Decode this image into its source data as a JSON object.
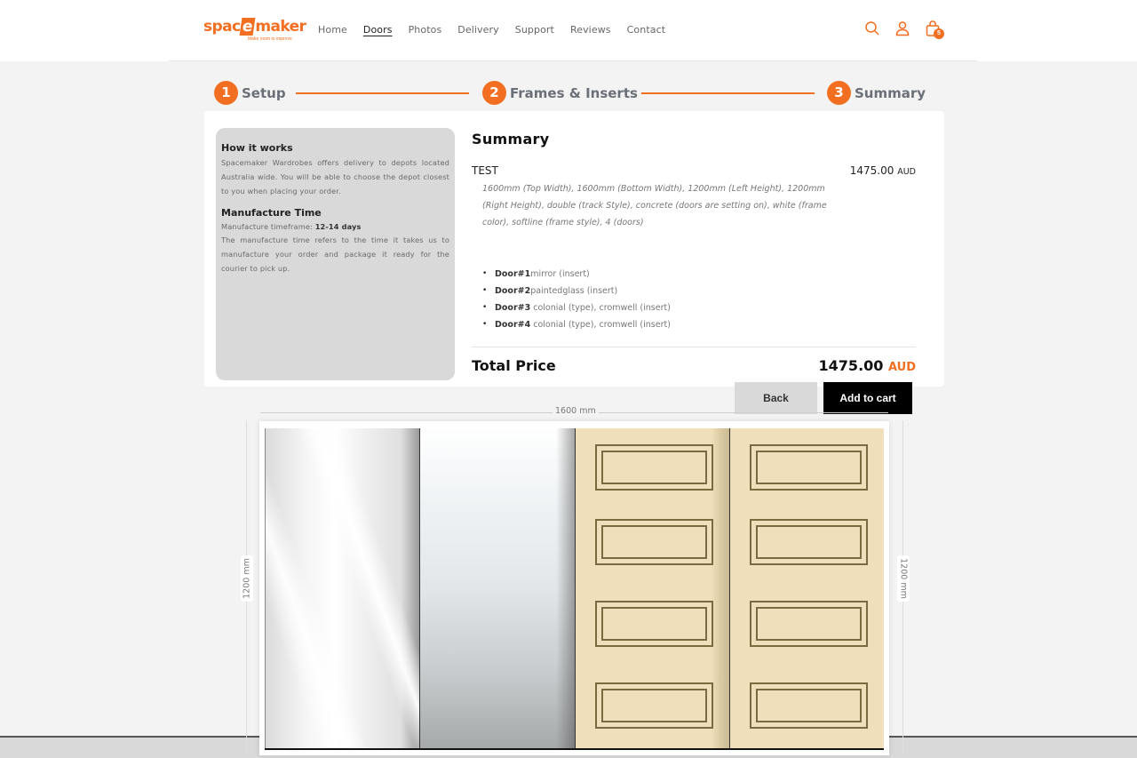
{
  "header": {
    "logo": {
      "prefix": "spac",
      "highlight": "e",
      "suffix": "maker",
      "tagline": "Make room to improve"
    },
    "nav": [
      {
        "label": "Home",
        "active": false
      },
      {
        "label": "Doors",
        "active": true
      },
      {
        "label": "Photos",
        "active": false
      },
      {
        "label": "Delivery",
        "active": false
      },
      {
        "label": "Support",
        "active": false
      },
      {
        "label": "Reviews",
        "active": false
      },
      {
        "label": "Contact",
        "active": false
      }
    ],
    "icons": [
      "search-icon",
      "account-icon",
      "cart-icon"
    ],
    "cart_count": "5"
  },
  "steps": [
    {
      "number": "1",
      "label": "Setup"
    },
    {
      "number": "2",
      "label": "Frames & Inserts"
    },
    {
      "number": "3",
      "label": "Summary"
    }
  ],
  "info": {
    "how_title": "How it works",
    "how_text": "Spacemaker Wardrobes offers delivery to depots located Australia wide. You will be able to choose the depot closest to you when placing your order.",
    "manufacture_title": "Manufacture Time",
    "timeframe_label": "Manufacture timeframe:",
    "timeframe_value": "12-14 days",
    "manufacture_text": "The manufacture time refers to the time it takes us to manufacture your order and package it ready for the courier to pick up."
  },
  "summary": {
    "title": "Summary",
    "item_name": "TEST",
    "item_price": "1475.00",
    "item_currency": "AUD",
    "item_description": "1600mm (Top Width), 1600mm (Bottom Width), 1200mm (Left Height), 1200mm (Right Height), double (track Style), concrete (doors are setting on), white (frame color), softline (frame style), 4 (doors)",
    "doors": [
      {
        "label": "Door#1",
        "detail": "mirror (insert)"
      },
      {
        "label": "Door#2",
        "detail": "paintedglass (insert)"
      },
      {
        "label": "Door#3",
        "detail": " colonial (type), cromwell (insert)"
      },
      {
        "label": "Door#4",
        "detail": " colonial (type), cromwell (insert)"
      }
    ],
    "total_label": "Total Price",
    "total_value": "1475.00",
    "total_currency": "AUD",
    "back_label": "Back",
    "add_to_cart_label": "Add to cart"
  },
  "preview": {
    "width_label": "1600 mm",
    "left_height_label": "1200 mm",
    "right_height_label": "1200 mm",
    "doors": [
      "mirror",
      "paintedglass",
      "colonial-cromwell",
      "colonial-cromwell"
    ]
  },
  "colors": {
    "accent": "#f26f21",
    "panel_bg": "#d9d9d9",
    "door_wood": "#efe0bb",
    "panel_trim": "#7a6a40"
  }
}
